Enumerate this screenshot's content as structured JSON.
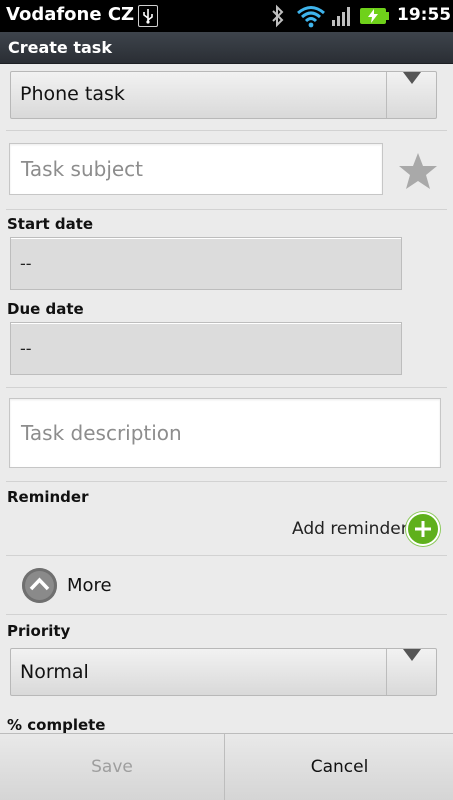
{
  "status_bar": {
    "carrier": "Vodafone CZ",
    "time": "19:55",
    "icons": [
      "usb-icon",
      "bluetooth-icon",
      "wifi-icon",
      "signal-icon",
      "battery-charging-icon"
    ],
    "battery_color": "#6fd11a",
    "wifi_color": "#3fb4ec"
  },
  "title_bar": {
    "title": "Create task"
  },
  "task_type": {
    "selected": "Phone task"
  },
  "subject": {
    "placeholder": "Task subject",
    "star_icon": "star-icon"
  },
  "start_date": {
    "label": "Start date",
    "value": "--"
  },
  "due_date": {
    "label": "Due date",
    "value": "--"
  },
  "description": {
    "placeholder": "Task description"
  },
  "reminder": {
    "label": "Reminder",
    "add_label": "Add reminder",
    "add_icon": "plus-circle-icon",
    "accent": "#5fb01c"
  },
  "more": {
    "label": "More",
    "icon": "chevron-up-icon"
  },
  "priority": {
    "label": "Priority",
    "selected": "Normal"
  },
  "percent_complete": {
    "label": "% complete"
  },
  "buttons": {
    "save": "Save",
    "cancel": "Cancel"
  }
}
